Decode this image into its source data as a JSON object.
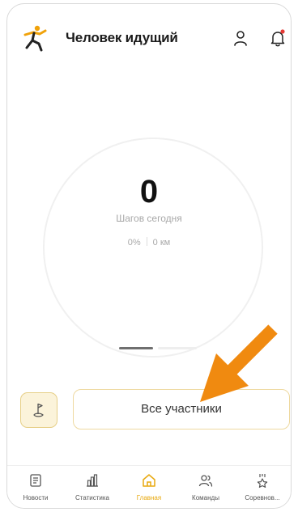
{
  "header": {
    "title": "Человек идущий"
  },
  "steps": {
    "value": "0",
    "label": "Шагов сегодня",
    "percent": "0%",
    "distance": "0 км"
  },
  "pager": {
    "total": 2,
    "active_index": 0
  },
  "actions": {
    "participants_label": "Все участники"
  },
  "nav": {
    "items": [
      {
        "label": "Новости",
        "icon": "news-icon"
      },
      {
        "label": "Статистика",
        "icon": "stats-icon"
      },
      {
        "label": "Главная",
        "icon": "home-icon"
      },
      {
        "label": "Команды",
        "icon": "teams-icon"
      },
      {
        "label": "Соревнов...",
        "icon": "competitions-icon"
      }
    ],
    "active": "Главная"
  },
  "colors": {
    "accent": "#e8a90f",
    "annotation": "#f08a10",
    "notification_dot": "#e53935"
  }
}
